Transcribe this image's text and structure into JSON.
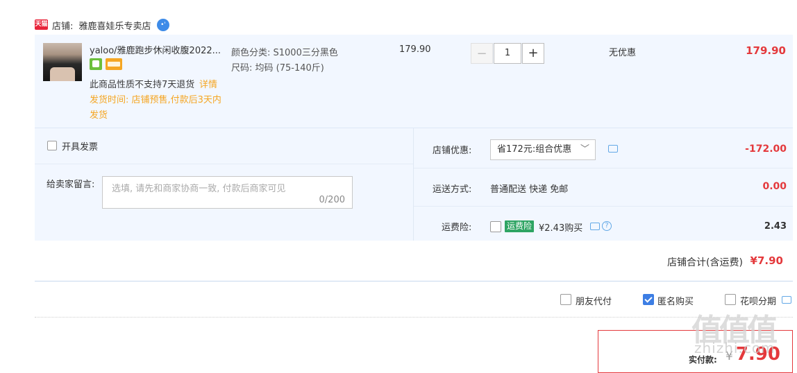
{
  "shop": {
    "badge": "天猫",
    "label": "店铺:",
    "name": "雅鹿喜娃乐专卖店",
    "chat_glyph": "•'"
  },
  "item": {
    "title": "yaloo/雅鹿跑步休闲收腹2022...",
    "sku_color": "颜色分类: S1000三分黑色",
    "sku_size": "尺码: 均码 (75-140斤)",
    "return_notice": "此商品性质不支持7天退货",
    "detail_link": "详情",
    "ship_time_line1": "发货时间: 店铺预售,付款后3天内",
    "ship_time_line2": "发货",
    "unit_price": "179.90",
    "quantity": "1",
    "minus": "−",
    "plus": "+",
    "discount": "无优惠",
    "subtotal": "179.90"
  },
  "options": {
    "invoice_label": "开具发票",
    "message_label": "给卖家留言:",
    "message_placeholder": "选填, 请先和商家协商一致, 付款后商家可见",
    "message_count": "0/200",
    "promo_label": "店铺优惠:",
    "promo_selected": "省172元:组合优惠",
    "promo_chevron": "﹀",
    "promo_amount": "-172.00",
    "shipping_label": "运送方式:",
    "shipping_value": "普通配送 快递 免邮",
    "shipping_amount": "0.00",
    "insurance_label": "运费险:",
    "insurance_tag": "运费险",
    "insurance_text": "¥2.43购买",
    "insurance_help": "?",
    "insurance_amount": "2.43"
  },
  "shop_total": {
    "label": "店铺合计(含运费)",
    "value": "¥7.90"
  },
  "payment_options": {
    "friend_pay": "朋友代付",
    "anonymous": "匿名购买",
    "huabei": "花呗分期"
  },
  "pay": {
    "label": "实付款:",
    "currency": "¥",
    "value": "7.90"
  },
  "watermark": {
    "main": "值值值",
    "site": "zhizhi.com"
  },
  "colors": {
    "accent_red": "#e4393c",
    "orange": "#f5a623",
    "row_bg": "#f2f7ff",
    "checkbox_blue": "#3d7ee4",
    "insurance_green": "#2ea463"
  }
}
